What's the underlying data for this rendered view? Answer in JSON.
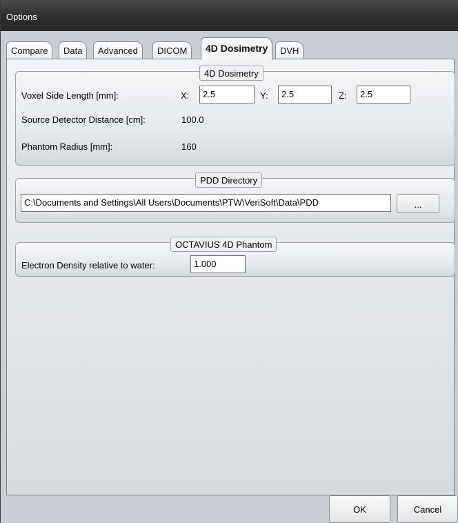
{
  "window": {
    "title": "Options"
  },
  "tabs": [
    {
      "label": "Compare"
    },
    {
      "label": "Data"
    },
    {
      "label": "Advanced"
    },
    {
      "label": "DICOM"
    },
    {
      "label": "4D Dosimetry",
      "selected": true
    },
    {
      "label": "DVH"
    }
  ],
  "dosimetry_group": {
    "title": "4D Dosimetry",
    "voxel_label": "Voxel Side Length [mm]:",
    "x_label": "X:",
    "x_value": "2.5",
    "y_label": "Y:",
    "y_value": "2.5",
    "z_label": "Z:",
    "z_value": "2.5",
    "sdd_label": "Source Detector Distance [cm]:",
    "sdd_value": "100.0",
    "phantom_radius_label": "Phantom Radius [mm]:",
    "phantom_radius_value": "160"
  },
  "pdd_group": {
    "title": "PDD Directory",
    "path_value": "C:\\Documents and Settings\\All Users\\Documents\\PTW\\VeriSoft\\Data\\PDD",
    "browse_label": "..."
  },
  "octavius_group": {
    "title": "OCTAVIUS 4D Phantom",
    "density_label": "Electron Density relative to water:",
    "density_value": "1.000"
  },
  "buttons": {
    "ok_label": "OK",
    "cancel_label": "Cancel"
  }
}
